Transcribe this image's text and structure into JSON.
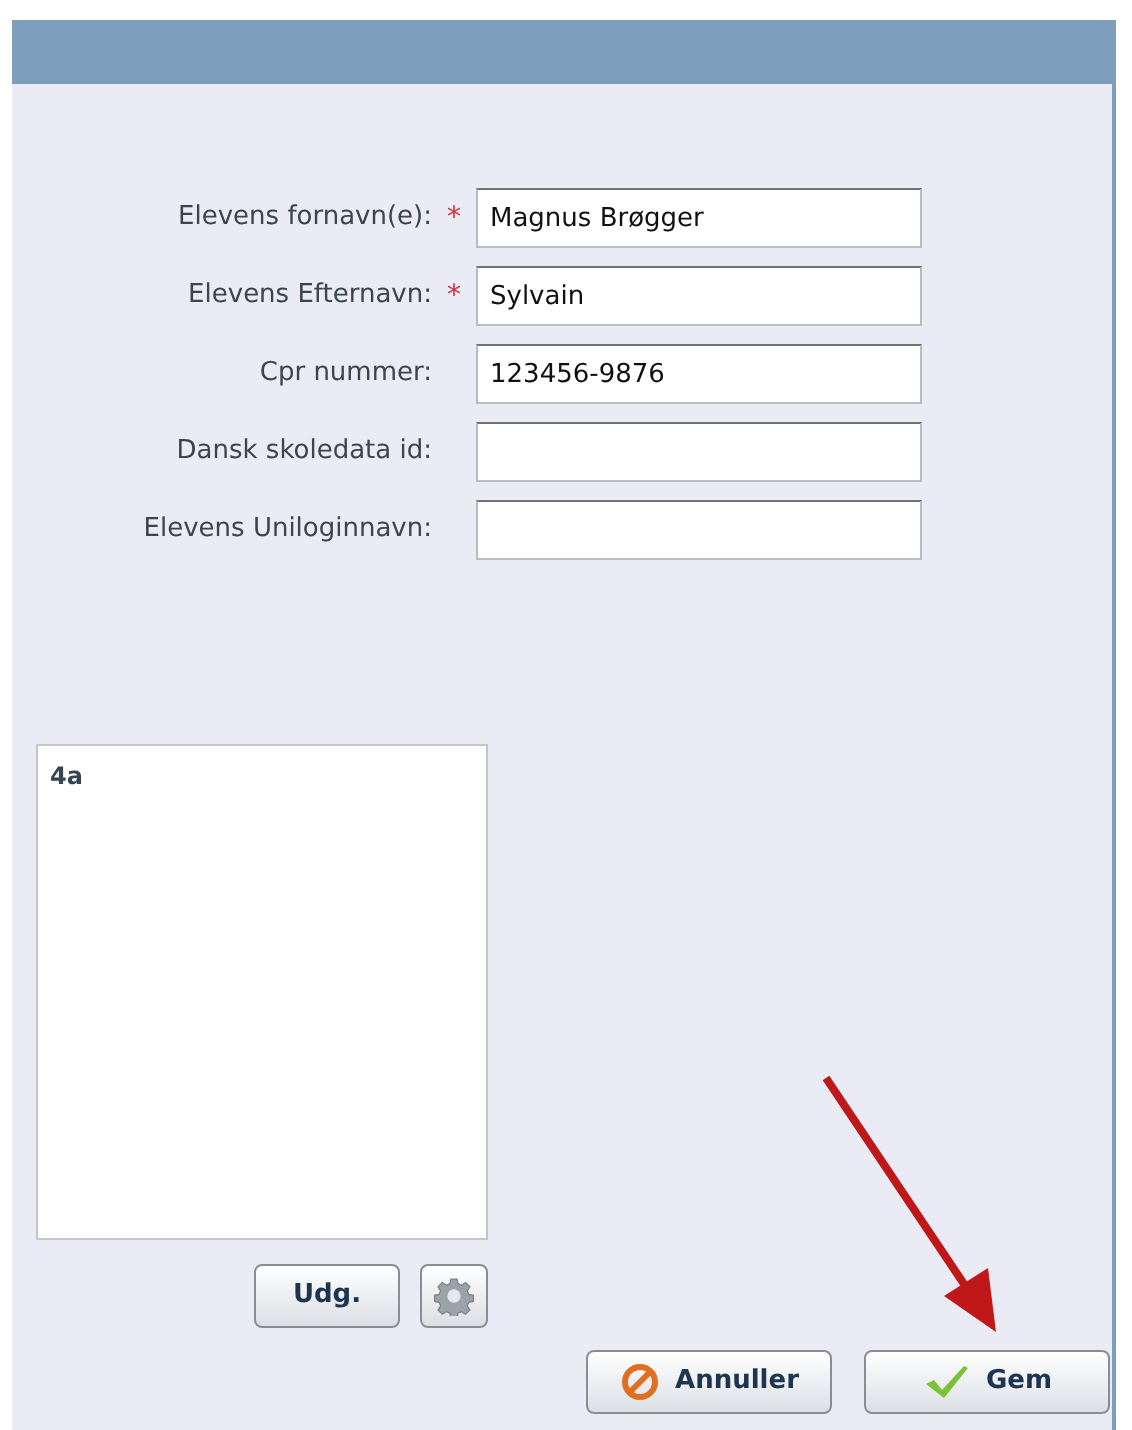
{
  "form": {
    "required_mark": "*",
    "fields": [
      {
        "label": "Elevens fornavn(e):",
        "required": true,
        "value": "Magnus Brøgger"
      },
      {
        "label": "Elevens Efternavn:",
        "required": true,
        "value": "Sylvain"
      },
      {
        "label": "Cpr nummer:",
        "required": false,
        "value": "123456-9876"
      },
      {
        "label": "Dansk skoledata id:",
        "required": false
      },
      {
        "label": "Elevens Uniloginnavn:",
        "required": false
      }
    ]
  },
  "class_list": {
    "items": [
      "4a"
    ],
    "edit_button": "Udg."
  },
  "buttons": [
    {
      "kind": "cancel",
      "label": "Annuller"
    },
    {
      "kind": "save",
      "label": "Gem"
    }
  ]
}
